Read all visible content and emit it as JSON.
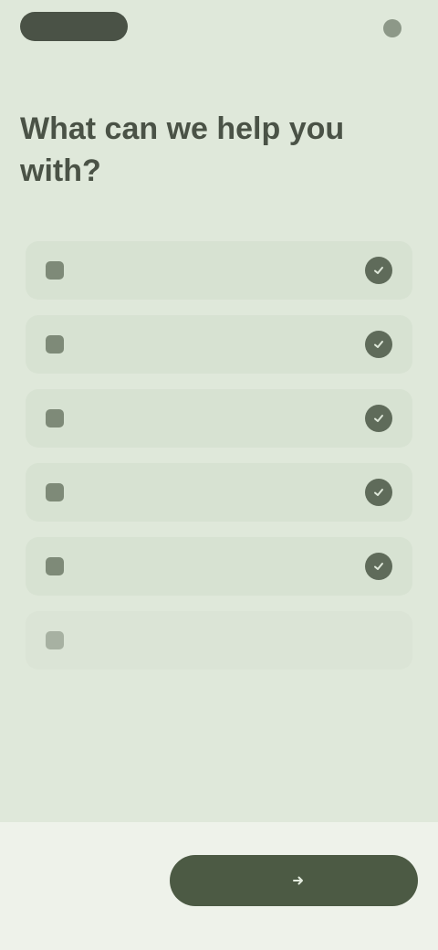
{
  "header": {
    "pill_label": "",
    "right_label": ""
  },
  "main": {
    "heading": "What can we help you with?",
    "subheading": "",
    "options": [
      {
        "label": "",
        "icon": "sparkle-icon",
        "selected": true
      },
      {
        "label": "",
        "icon": "chart-icon",
        "selected": true
      },
      {
        "label": "",
        "icon": "calendar-icon",
        "selected": true
      },
      {
        "label": "",
        "icon": "list-icon",
        "selected": true
      },
      {
        "label": "",
        "icon": "grid-icon",
        "selected": true
      },
      {
        "label": "",
        "icon": "other-icon",
        "selected": false
      }
    ]
  },
  "footer": {
    "skip_label": "",
    "continue_label": ""
  },
  "colors": {
    "background": "#dfe8da",
    "accent": "#4c5a44",
    "option_background": "#d7e2d2",
    "check": "#5f6b5a"
  }
}
